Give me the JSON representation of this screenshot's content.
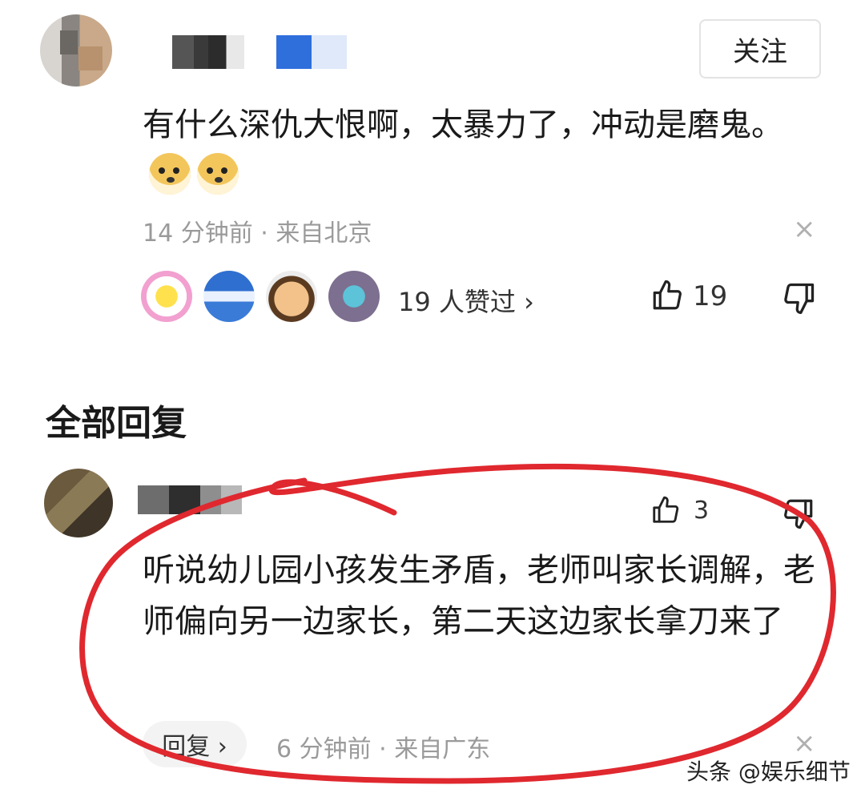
{
  "top_comment": {
    "follow_label": "关注",
    "text": "有什么深仇大恨啊，太暴力了，冲动是磨鬼。",
    "emojis": [
      "doge-emoji",
      "doge-emoji"
    ],
    "time": "14 分钟前",
    "separator": "·",
    "location": "来自北京",
    "likers_label": "19 人赞过",
    "likers_chevron": "›",
    "like_count": "19",
    "close_symbol": "×"
  },
  "replies_section": {
    "title": "全部回复"
  },
  "reply": {
    "like_count": "3",
    "text": "听说幼儿园小孩发生矛盾，老师叫家长调解，老师偏向另一边家长，第二天这边家长拿刀来了",
    "reply_button": "回复 ›",
    "time": "6 分钟前",
    "separator": "·",
    "location": "来自广东",
    "close_symbol": "×"
  },
  "watermark": "头条 @娱乐细节",
  "colors": {
    "annotation_circle": "#e0282f",
    "meta_text": "#9a9a9a"
  },
  "icons": [
    "thumbs-up-icon",
    "thumbs-down-icon",
    "close-icon",
    "chevron-right-icon"
  ]
}
